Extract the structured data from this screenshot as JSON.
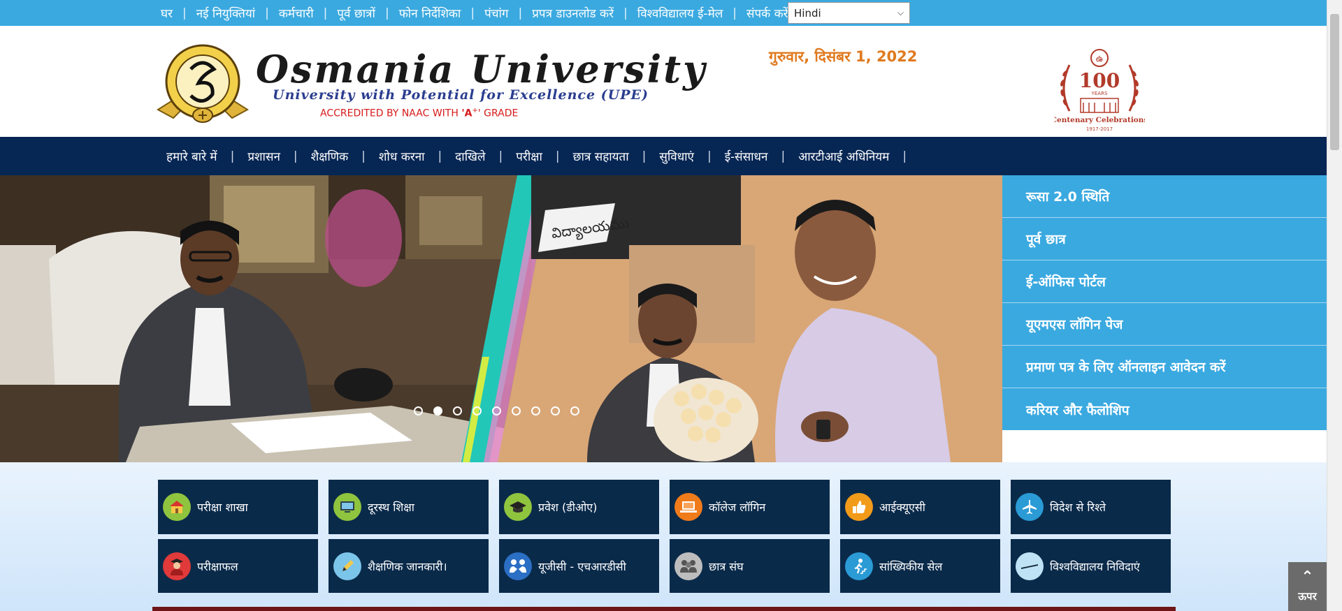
{
  "topbar": {
    "links": [
      {
        "label": "घर"
      },
      {
        "label": "नई नियुक्तियां"
      },
      {
        "label": "कर्मचारी"
      },
      {
        "label": "पूर्व छात्रों"
      },
      {
        "label": "फोन निर्देशिका"
      },
      {
        "label": "पंचांग"
      },
      {
        "label": "प्रपत्र डाउनलोड करें"
      },
      {
        "label": "विश्वविद्यालय ई-मेल"
      },
      {
        "label": "संपर्क करें"
      }
    ],
    "separator": "|",
    "language_selected": "Hindi"
  },
  "header": {
    "title": "Osmania University",
    "subtitle": "University with Potential for Excellence (UPE)",
    "accreditation_pre": "ACCREDITED BY NAAC WITH ",
    "accreditation_grade": "'A",
    "accreditation_plus": "+",
    "accreditation_post": "' GRADE",
    "date": "गुरुवार, दिसंबर 1, 2022",
    "centenary_number": "100",
    "centenary_years": "YEARS",
    "centenary_label": "Centenary Celebrations",
    "centenary_span": "1917-2017"
  },
  "mainnav": {
    "items": [
      {
        "label": "हमारे बारे में"
      },
      {
        "label": "प्रशासन"
      },
      {
        "label": "शैक्षणिक"
      },
      {
        "label": "शोध करना"
      },
      {
        "label": "दाखिले"
      },
      {
        "label": "परीक्षा"
      },
      {
        "label": "छात्र सहायता"
      },
      {
        "label": "सुविधाएं"
      },
      {
        "label": "ई-संसाधन"
      },
      {
        "label": "आरटीआई अधिनियम"
      }
    ],
    "separator": "|"
  },
  "slider": {
    "banner_text": "విద్యాలయము",
    "dot_count": 9,
    "active_dot": 2
  },
  "quick_links": [
    {
      "label": "रूसा 2.0 स्थिति"
    },
    {
      "label": "पूर्व छात्र"
    },
    {
      "label": "ई-ऑफिस पोर्टल"
    },
    {
      "label": "यूएमएस लॉगिन पेज"
    },
    {
      "label": "प्रमाण पत्र के लिए ऑनलाइन आवेदन करें"
    },
    {
      "label": "करियर और फैलोशिप"
    }
  ],
  "tiles": [
    {
      "label": "परीक्षा शाखा",
      "icon": "school-building-icon",
      "color": "#8fc43e"
    },
    {
      "label": "दूरस्थ शिक्षा",
      "icon": "monitor-icon",
      "color": "#8fc43e"
    },
    {
      "label": "प्रवेश (डीओए)",
      "icon": "graduation-cap-icon",
      "color": "#8fc43e"
    },
    {
      "label": "कॉलेज लॉगिन",
      "icon": "laptop-icon",
      "color": "#f07b1b"
    },
    {
      "label": "आईक्यूएसी",
      "icon": "thumbs-up-icon",
      "color": "#f29a1a"
    },
    {
      "label": "विदेश से रिश्ते",
      "icon": "airplane-icon",
      "color": "#2b9bd6"
    },
    {
      "label": "परीक्षाफल",
      "icon": "graduate-student-icon",
      "color": "#e03a3a"
    },
    {
      "label": "शैक्षणिक जानकारी।",
      "icon": "pencil-icon",
      "color": "#7cc5ea"
    },
    {
      "label": "यूजीसी - एचआरडीसी",
      "icon": "people-meeting-icon",
      "color": "#2b6fc4"
    },
    {
      "label": "छात्र संघ",
      "icon": "group-icon",
      "color": "#bdbdbd"
    },
    {
      "label": "सांख्यिकीय सेल",
      "icon": "stairs-climb-icon",
      "color": "#2b9bd6"
    },
    {
      "label": "विश्वविद्यालय निविदाएं",
      "icon": "minus-bar-icon",
      "color": "#bfe3f5"
    }
  ],
  "back_to_top": {
    "label": "ऊपर"
  }
}
